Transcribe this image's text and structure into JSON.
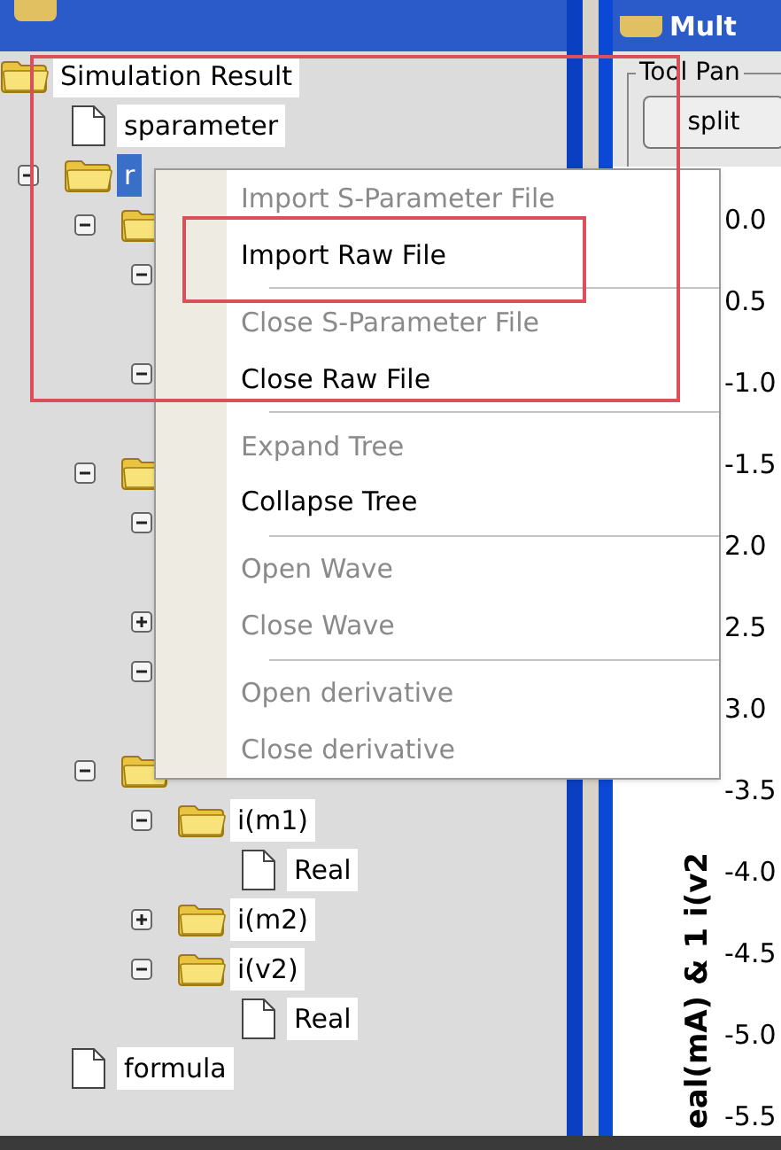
{
  "tree": [
    {
      "kind": "folder",
      "label": "Simulation Result",
      "selected": false,
      "children": [
        {
          "kind": "file",
          "label": "sparameter",
          "selected": false
        },
        {
          "kind": "folder",
          "label": "r",
          "selected": true,
          "expanded": true,
          "children": [
            {
              "kind": "folder",
              "expanded": true,
              "children": [
                {
                  "expanded": true
                },
                {
                  "expanded": true
                }
              ]
            },
            {
              "kind": "folder",
              "expanded": true,
              "children": [
                {
                  "expanded": true
                },
                {
                  "expanded": false
                },
                {
                  "expanded": true
                }
              ]
            },
            {
              "kind": "folder",
              "expanded": true,
              "children": [
                {
                  "kind": "folder",
                  "label": "i(m1)",
                  "selected": false,
                  "expanded": true,
                  "children": [
                    {
                      "kind": "file",
                      "label": "Real",
                      "selected": false
                    }
                  ]
                },
                {
                  "kind": "folder",
                  "label": "i(m2)",
                  "selected": false,
                  "expanded": false
                },
                {
                  "kind": "folder",
                  "label": "i(v2)",
                  "selected": false,
                  "expanded": true,
                  "children": [
                    {
                      "kind": "file",
                      "label": "Real",
                      "selected": false
                    }
                  ]
                }
              ]
            }
          ]
        },
        {
          "kind": "file",
          "label": "formula",
          "selected": false
        }
      ]
    }
  ],
  "plot_window": {
    "title": "Mult",
    "tool_panel": {
      "title": "Tool Pan",
      "buttons": [
        "split"
      ]
    },
    "y_axis_label": "eal(mA) & 1 i(v2",
    "y_ticks": [
      "0.0",
      "0.5",
      "-1.0",
      "-1.5",
      "2.0",
      "2.5",
      "3.0",
      "-3.5",
      "-4.0",
      "-4.5",
      "-5.0",
      "-5.5"
    ]
  },
  "context_menu": {
    "items": [
      {
        "label": "Import S-Parameter File",
        "disabled": true,
        "separator_after": false
      },
      {
        "label": "Import Raw File",
        "disabled": false,
        "separator_after": true
      },
      {
        "label": "Close S-Parameter File",
        "disabled": true,
        "separator_after": false
      },
      {
        "label": "Close Raw File",
        "disabled": false,
        "separator_after": true
      },
      {
        "label": "Expand Tree",
        "disabled": true,
        "separator_after": false
      },
      {
        "label": "Collapse Tree",
        "disabled": false,
        "separator_after": true
      },
      {
        "label": "Open Wave",
        "disabled": true,
        "separator_after": false
      },
      {
        "label": "Close Wave",
        "disabled": true,
        "separator_after": true
      },
      {
        "label": "Open derivative",
        "disabled": true,
        "separator_after": false
      },
      {
        "label": "Close derivative",
        "disabled": true,
        "separator_after": false
      }
    ]
  }
}
